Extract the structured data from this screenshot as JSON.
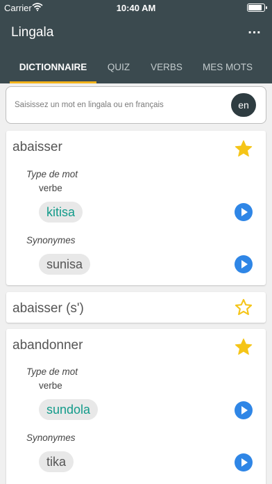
{
  "status_bar": {
    "carrier": "Carrier",
    "time": "10:40 AM"
  },
  "app": {
    "title": "Lingala",
    "more_icon": "ellipsis-icon"
  },
  "tabs": [
    {
      "label": "DICTIONNAIRE",
      "active": true
    },
    {
      "label": "QUIZ",
      "active": false
    },
    {
      "label": "VERBS",
      "active": false
    },
    {
      "label": "MES MOTS",
      "active": false
    }
  ],
  "search": {
    "value": "",
    "placeholder": "Saisissez un mot en lingala ou en français",
    "lang_button": "en"
  },
  "entries": [
    {
      "word": "abaisser",
      "favorite": true,
      "type_label": "Type de mot",
      "type_value": "verbe",
      "translation": "kitisa",
      "synonyms_label": "Synonymes",
      "synonym": "sunisa"
    },
    {
      "word": "abaisser (s')",
      "favorite": false
    },
    {
      "word": "abandonner",
      "favorite": true,
      "type_label": "Type de mot",
      "type_value": "verbe",
      "translation": "sundola",
      "synonyms_label": "Synonymes",
      "synonym": "tika"
    }
  ],
  "colors": {
    "app_bar": "#3b4a4f",
    "tab_indicator": "#f3b31b",
    "star": "#f5c518",
    "translation_text": "#129b8a",
    "play_button": "#2f86e6"
  }
}
